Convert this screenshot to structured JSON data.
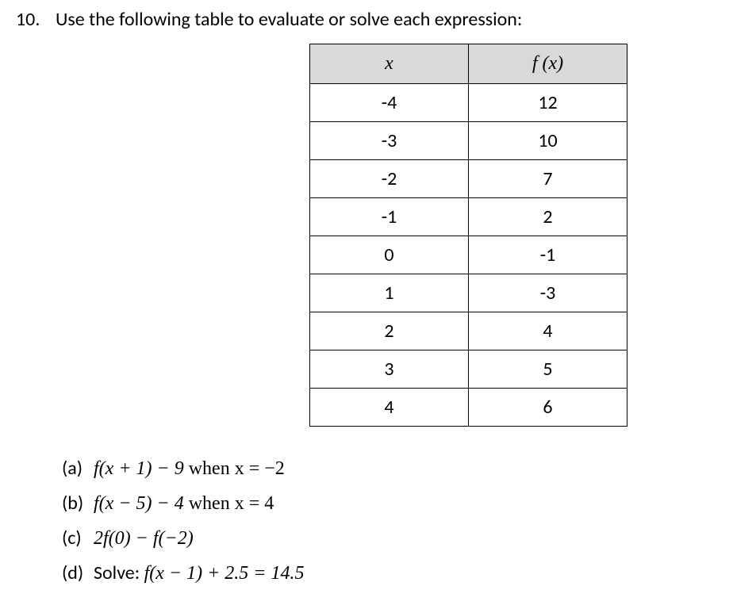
{
  "question": {
    "number": "10.",
    "text": "Use the following table to evaluate or solve each expression:"
  },
  "table": {
    "headers": {
      "col1": "x",
      "col2": "f (x)"
    },
    "rows": [
      {
        "x": "-4",
        "fx": "12"
      },
      {
        "x": "-3",
        "fx": "10"
      },
      {
        "x": "-2",
        "fx": "7"
      },
      {
        "x": "-1",
        "fx": "2"
      },
      {
        "x": "0",
        "fx": "-1"
      },
      {
        "x": "1",
        "fx": "-3"
      },
      {
        "x": "2",
        "fx": "4"
      },
      {
        "x": "3",
        "fx": "5"
      },
      {
        "x": "4",
        "fx": "6"
      }
    ]
  },
  "parts": {
    "a": {
      "label": "(a)",
      "expr": "f(x + 1) − 9",
      "cond": "  when x = −2"
    },
    "b": {
      "label": "(b)",
      "expr": "f(x − 5) − 4",
      "cond": "  when x = 4"
    },
    "c": {
      "label": "(c)",
      "expr": "2f(0) − f(−2)",
      "cond": ""
    },
    "d": {
      "label": "(d)",
      "prefix": "Solve:  ",
      "expr": "f(x − 1) + 2.5 = 14.5"
    }
  }
}
